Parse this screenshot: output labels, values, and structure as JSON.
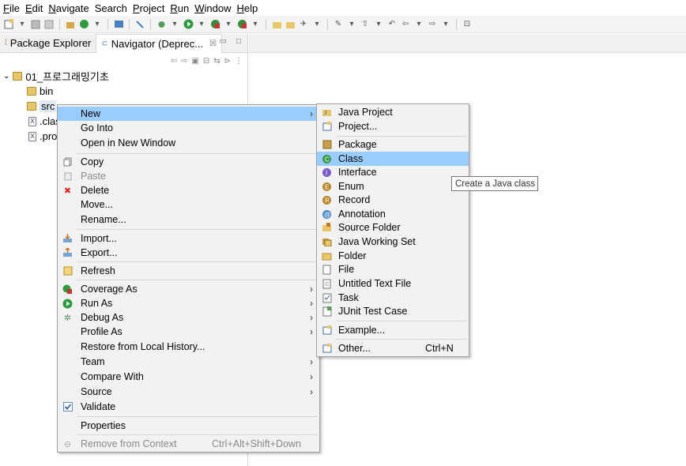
{
  "menubar": {
    "items": [
      {
        "u": "F",
        "rest": "ile"
      },
      {
        "u": "E",
        "rest": "dit"
      },
      {
        "u": "N",
        "rest": "avigate"
      },
      {
        "u": "",
        "rest": "Search"
      },
      {
        "u": "P",
        "rest": "roject"
      },
      {
        "u": "R",
        "rest": "un"
      },
      {
        "u": "W",
        "rest": "indow"
      },
      {
        "u": "H",
        "rest": "elp"
      }
    ]
  },
  "views": {
    "tab1": "Package Explorer",
    "tab2": "Navigator (Deprec...",
    "close": "☒"
  },
  "tree": {
    "project": "01_프로그래밍기초",
    "bin": "bin",
    "src": "src",
    "classpath": ".clas",
    "project_file": ".pro"
  },
  "context_menu": {
    "new": "New",
    "go_into": "Go Into",
    "open_new_window": "Open in New Window",
    "copy": "Copy",
    "paste": "Paste",
    "delete": "Delete",
    "move": "Move...",
    "rename": "Rename...",
    "import": "Import...",
    "export": "Export...",
    "refresh": "Refresh",
    "coverage_as": "Coverage As",
    "run_as": "Run As",
    "debug_as": "Debug As",
    "profile_as": "Profile As",
    "restore_history": "Restore from Local History...",
    "team": "Team",
    "compare_with": "Compare With",
    "source": "Source",
    "validate": "Validate",
    "properties": "Properties",
    "remove_context": "Remove from Context",
    "remove_context_shortcut": "Ctrl+Alt+Shift+Down",
    "arrow": "›"
  },
  "new_submenu": {
    "java_project": "Java Project",
    "project": "Project...",
    "package": "Package",
    "class": "Class",
    "interface": "Interface",
    "enum": "Enum",
    "record": "Record",
    "annotation": "Annotation",
    "source_folder": "Source Folder",
    "java_working_set": "Java Working Set",
    "folder": "Folder",
    "file": "File",
    "untitled_text_file": "Untitled Text File",
    "task": "Task",
    "junit_test_case": "JUnit Test Case",
    "example": "Example...",
    "other": "Other...",
    "other_shortcut": "Ctrl+N"
  },
  "tooltip": "Create a Java class",
  "colors": {
    "highlight": "#99ccff",
    "menu_bg": "#f2f2f2"
  }
}
